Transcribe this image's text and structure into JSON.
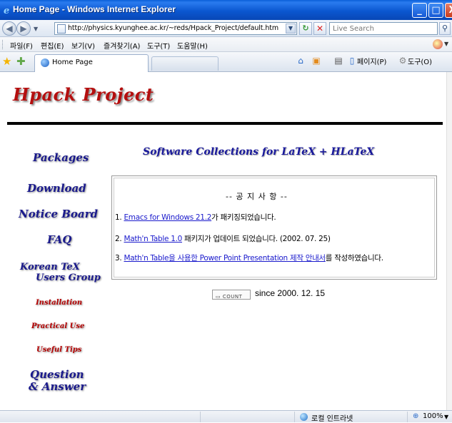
{
  "window": {
    "title": "Home Page - Windows Internet Explorer",
    "min_glyph": "_",
    "max_glyph": "□",
    "close_glyph": "X"
  },
  "address_bar": {
    "url": "http://physics.kyunghee.ac.kr/~reds/Hpack_Project/default.htm",
    "search_placeholder": "Live Search"
  },
  "menu": {
    "items": [
      "파일(F)",
      "편집(E)",
      "보기(V)",
      "즐겨찾기(A)",
      "도구(T)",
      "도움말(H)"
    ]
  },
  "tabs": {
    "active_label": "Home Page"
  },
  "command_bar": {
    "page_label": "페이지(P)",
    "tools_label": "도구(O)"
  },
  "page": {
    "logo": "Hpack Project",
    "subtitle": "Software Collections for LaTeX + HLaTeX",
    "nav": [
      {
        "label": "Packages"
      },
      {
        "label": "Download"
      },
      {
        "label": "Notice Board"
      },
      {
        "label": "FAQ"
      },
      {
        "label": "Korean TeX"
      },
      {
        "label": "Users Group"
      },
      {
        "label": "Installation"
      },
      {
        "label": "Practical Use"
      },
      {
        "label": "Useful Tips"
      },
      {
        "label": "Question"
      },
      {
        "label": "& Answer"
      }
    ],
    "notice": {
      "title": "-- 공 지 사 항 --",
      "items": [
        {
          "num": "1.",
          "link": "Emacs for Windows 21.2",
          "rest": "가 패키징되었습니다."
        },
        {
          "num": "2.",
          "link": "Math'n Table 1.0",
          "rest": " 패키지가 업데이트 되었습니다. (2002. 07. 25)"
        },
        {
          "num": "3.",
          "link": "Math'n Table을 사용한 Power Point Presentation 제작 안내서",
          "rest": "를 작성하였습니다."
        }
      ]
    },
    "counter_label": "COUNT",
    "since_text": "since 2000. 12. 15"
  },
  "status_bar": {
    "zone": "로컬 인트라넷",
    "zoom": "100%"
  }
}
